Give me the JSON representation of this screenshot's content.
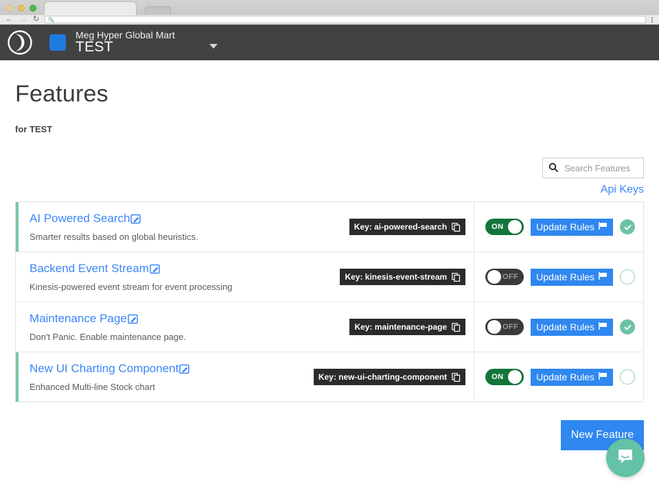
{
  "browser": {
    "back_icon": "back-arrow-icon",
    "forward_icon": "forward-arrow-icon",
    "reload_icon": "reload-icon",
    "address_value": "",
    "address_placeholder": "",
    "menu_icon": "kebab-menu-icon"
  },
  "header": {
    "logo_icon": "crescent-swirl-logo",
    "org_swatch_color": "#1f7ae0",
    "org_name": "Meg Hyper Global Mart",
    "environment": "TEST",
    "caret_icon": "chevron-down-icon"
  },
  "page": {
    "title": "Features",
    "subtitle_prefix": "for",
    "subtitle_env": "TEST",
    "subtitle": "for TEST"
  },
  "search": {
    "icon": "search-icon",
    "value": "",
    "placeholder": "Search Features"
  },
  "links": {
    "api_keys": "Api Keys"
  },
  "colors": {
    "accent_blue": "#2f87f0",
    "link_blue": "#3b86f7",
    "toggle_on_green": "#13753b",
    "toggle_off_gray": "#3a3a3a",
    "status_green": "#6cc3a1",
    "flag_bar_green": "#78c9a3",
    "header_dark": "#424242",
    "key_badge_dark": "#2b2b2b"
  },
  "labels": {
    "toggle_on": "ON",
    "toggle_off": "OFF",
    "update_rules": "Update Rules",
    "new_feature": "New Feature",
    "key_prefix": "Key:",
    "edit_icon": "edit-pencil-icon",
    "copy_icon": "copy-icon",
    "flag_icon": "flag-icon",
    "check_icon": "check-icon",
    "chat_icon": "chat-bubble-icon"
  },
  "features": [
    {
      "name": "AI Powered Search",
      "description": "Smarter results based on global heuristics.",
      "key_label": "Key: ai-powered-search",
      "key": "ai-powered-search",
      "toggle_state": "ON",
      "toggle_on": true,
      "flag_bar": true,
      "status_checked": true,
      "update_label": "Update Rules"
    },
    {
      "name": "Backend Event Stream",
      "description": "Kinesis-powered event stream for event processing",
      "key_label": "Key: kinesis-event-stream",
      "key": "kinesis-event-stream",
      "toggle_state": "OFF",
      "toggle_on": false,
      "flag_bar": false,
      "status_checked": false,
      "update_label": "Update Rules"
    },
    {
      "name": "Maintenance Page",
      "description": "Don't Panic. Enable maintenance page.",
      "key_label": "Key: maintenance-page",
      "key": "maintenance-page",
      "toggle_state": "OFF",
      "toggle_on": false,
      "flag_bar": false,
      "status_checked": true,
      "update_label": "Update Rules"
    },
    {
      "name": "New UI Charting Component",
      "description": "Enhanced Multi-line Stock chart",
      "key_label": "Key: new-ui-charting-component",
      "key": "new-ui-charting-component",
      "toggle_state": "ON",
      "toggle_on": true,
      "flag_bar": true,
      "status_checked": false,
      "update_label": "Update Rules"
    }
  ]
}
